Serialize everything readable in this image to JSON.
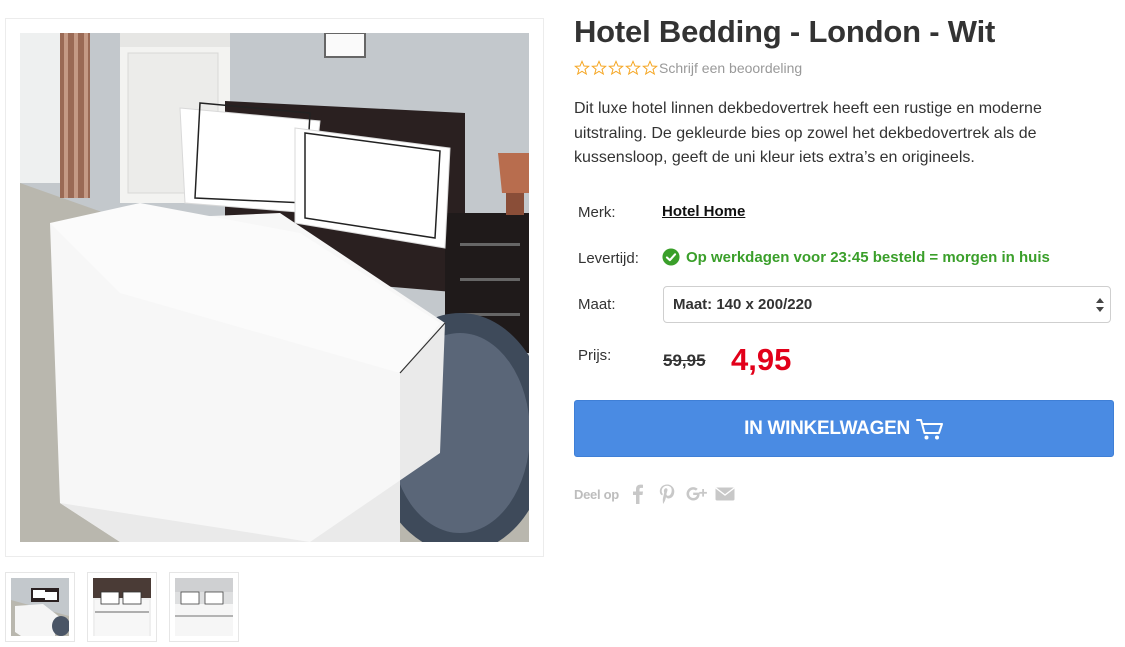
{
  "product": {
    "title": "Hotel Bedding - London - Wit",
    "review_link": "Schrijf een beoordeling",
    "rating_stars": 0,
    "rating_max": 5,
    "description": "Dit luxe hotel linnen dekbedovertrek heeft een rustige en moderne uitstraling. De gekleurde bies op zowel het dekbedovertrek als de kussensloop, geeft de uni kleur iets extra’s en origineels."
  },
  "specs": {
    "brand_label": "Merk:",
    "brand_value": "Hotel Home",
    "delivery_label": "Levertijd:",
    "delivery_value": "Op werkdagen voor 23:45 besteld = morgen in huis",
    "size_label": "Maat:",
    "size_value": "Maat: 140 x 200/220",
    "price_label": "Prijs:",
    "price_old": "59,95",
    "price_new": "4,95"
  },
  "cart": {
    "button_label": "IN WINKELWAGEN"
  },
  "share": {
    "label": "Deel op",
    "icons": [
      "facebook-icon",
      "pinterest-icon",
      "google-plus-icon",
      "email-icon"
    ]
  },
  "colors": {
    "accent_blue": "#4a8be3",
    "price_red": "#e2001a",
    "delivery_green": "#3a9f2a",
    "star_outline": "#f5a623"
  }
}
